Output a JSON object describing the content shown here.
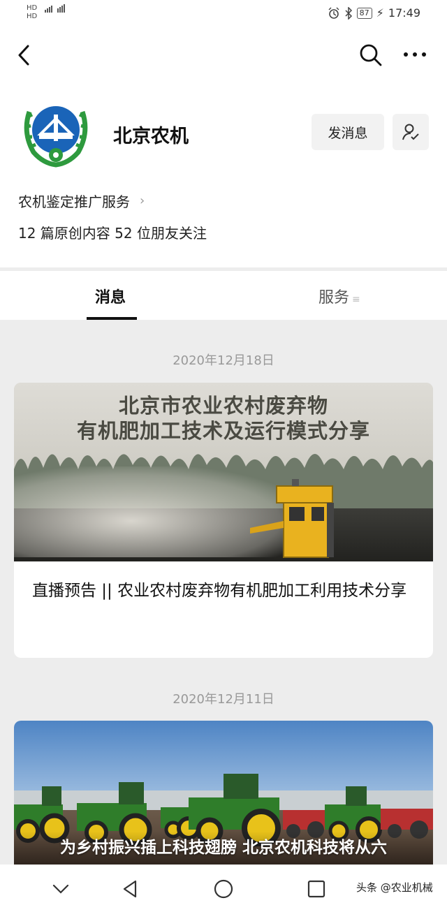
{
  "status_bar": {
    "left_top": "HD",
    "left_bottom": "HD",
    "battery": "87",
    "time": "17:49"
  },
  "account": {
    "name": "北京农机",
    "message_button": "发消息",
    "category": "农机鉴定推广服务",
    "stats": "12 篇原创内容  52 位朋友关注"
  },
  "tabs": [
    {
      "label": "消息"
    },
    {
      "label": "服务"
    }
  ],
  "feed": [
    {
      "date": "2020年12月18日",
      "cover_headline_1": "北京市农业农村废弃物",
      "cover_headline_2": "有机肥加工技术及运行模式分享",
      "title": "直播预告 || 农业农村废弃物有机肥加工利用技术分享"
    },
    {
      "date": "2020年12月11日",
      "cover_caption": "为乡村振兴插上科技翅膀 北京农机科技将从六"
    }
  ],
  "watermark": "头条 @农业机械",
  "colors": {
    "logo_green": "#2e9a3e",
    "logo_blue": "#1a64b8",
    "tractor_green": "#2f7d2a",
    "tractor_yellow": "#e8c21a",
    "machine_yellow": "#e9b21f"
  }
}
